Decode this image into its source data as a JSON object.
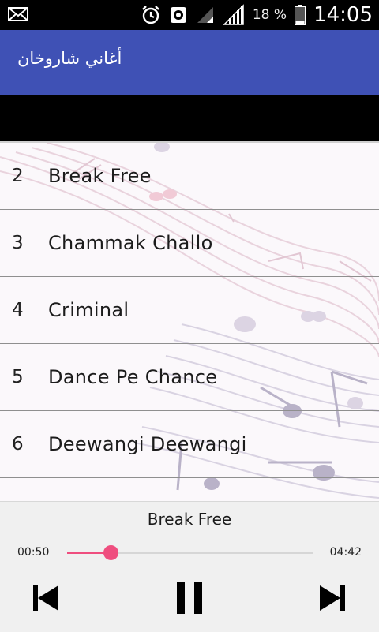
{
  "status_bar": {
    "battery_percent": "18 %",
    "time": "14:05",
    "icons": [
      "mail-icon",
      "alarm-icon",
      "data-sync-icon",
      "signal-icon",
      "signal-icon",
      "battery-icon"
    ]
  },
  "app_bar": {
    "title": "أغاني شاروخان",
    "color": "#3f51b5"
  },
  "songs": [
    {
      "num": "2",
      "title": "Break Free"
    },
    {
      "num": "3",
      "title": "Chammak Challo"
    },
    {
      "num": "4",
      "title": "Criminal"
    },
    {
      "num": "5",
      "title": "Dance Pe Chance"
    },
    {
      "num": "6",
      "title": "Deewangi Deewangi"
    }
  ],
  "player": {
    "now_playing": "Break Free",
    "elapsed": "00:50",
    "total": "04:42",
    "progress": 0.177,
    "accent": "#ef4e7f"
  }
}
